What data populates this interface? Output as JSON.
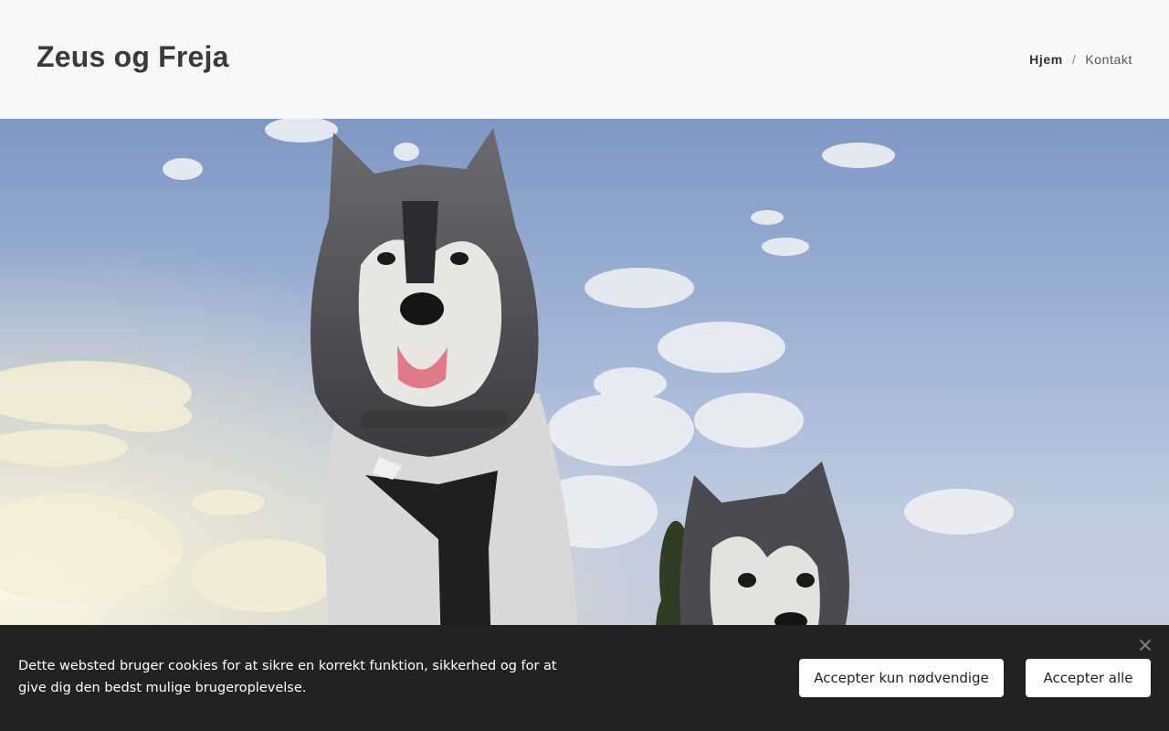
{
  "header": {
    "site_title": "Zeus og Freja",
    "nav": [
      {
        "label": "Hjem",
        "active": true
      },
      {
        "label": "Kontakt",
        "active": false
      }
    ],
    "separator": "/"
  },
  "hero": {
    "image_semantic": "two-huskies-under-cloudy-sky"
  },
  "cookie_banner": {
    "message": "Dette websted bruger cookies for at sikre en korrekt funktion, sikkerhed og for at give dig den bedst mulige brugeroplevelse.",
    "accept_necessary_label": "Accepter kun nødvendige",
    "accept_all_label": "Accepter alle",
    "close_icon": "close-icon"
  },
  "colors": {
    "header_bg": "#f7f6f9",
    "title": "#3a3a3a",
    "banner_bg": "#222222",
    "button_bg": "#ffffff"
  }
}
